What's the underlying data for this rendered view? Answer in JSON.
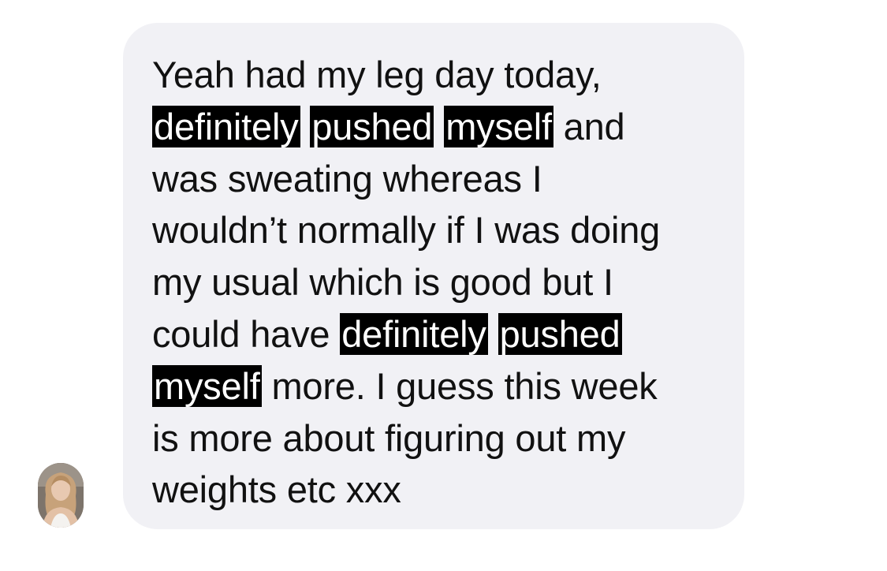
{
  "sender": {
    "avatar_icon": "profile-photo"
  },
  "message": {
    "lines": [
      [
        {
          "text": "Yeah had my leg day today,",
          "redacted": false
        }
      ],
      [
        {
          "text": "definitely",
          "redacted": true
        },
        {
          "text": " ",
          "redacted": false
        },
        {
          "text": "pushed",
          "redacted": true
        },
        {
          "text": " ",
          "redacted": false
        },
        {
          "text": "myself",
          "redacted": true
        },
        {
          "text": " and",
          "redacted": false
        }
      ],
      [
        {
          "text": "was sweating whereas I",
          "redacted": false
        }
      ],
      [
        {
          "text": "wouldn’t normally if I was doing",
          "redacted": false
        }
      ],
      [
        {
          "text": "my usual which is good but I",
          "redacted": false
        }
      ],
      [
        {
          "text": "could have ",
          "redacted": false
        },
        {
          "text": "definitely",
          "redacted": true
        },
        {
          "text": " ",
          "redacted": false
        },
        {
          "text": "pushed",
          "redacted": true
        }
      ],
      [
        {
          "text": "myself",
          "redacted": true
        },
        {
          "text": " more. I guess this week",
          "redacted": false
        }
      ],
      [
        {
          "text": "is more about figuring out my",
          "redacted": false
        }
      ],
      [
        {
          "text": "weights etc xxx",
          "redacted": false
        }
      ]
    ]
  },
  "colors": {
    "bubble_background": "#f1f1f5",
    "text": "#111111",
    "redaction": "#000000"
  }
}
